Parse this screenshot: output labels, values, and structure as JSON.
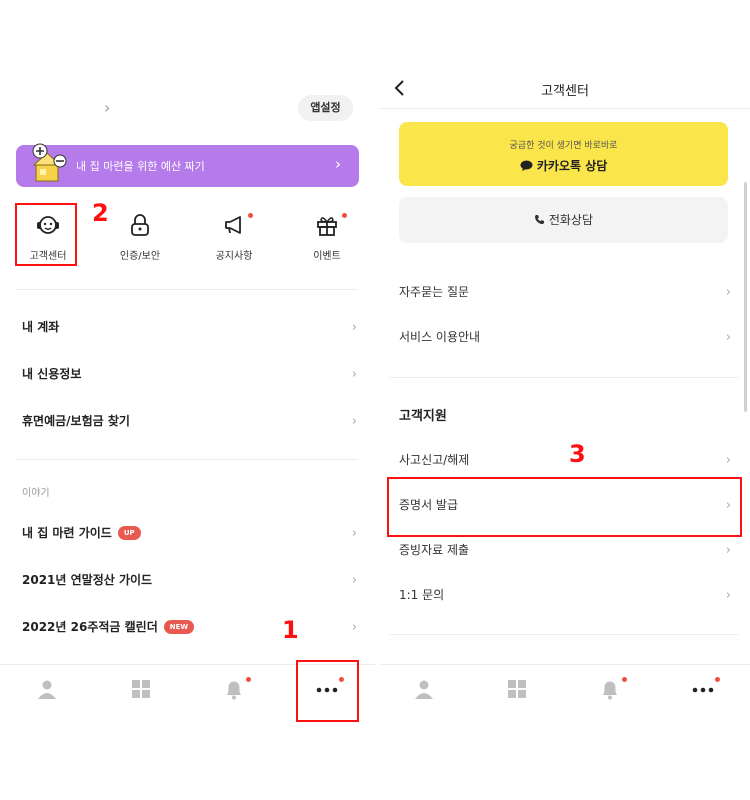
{
  "left": {
    "app_settings_label": "앱설정",
    "banner": {
      "text": "내 집 마련을 위한 예산 짜기",
      "color": "#b57bea"
    },
    "quick_menu": [
      {
        "label": "고객센터",
        "icon": "headset-icon"
      },
      {
        "label": "인증/보안",
        "icon": "lock-icon"
      },
      {
        "label": "공지사항",
        "icon": "megaphone-icon"
      },
      {
        "label": "이벤트",
        "icon": "gift-icon"
      }
    ],
    "menu": [
      {
        "label": "내 계좌"
      },
      {
        "label": "내 신용정보"
      },
      {
        "label": "휴면예금/보험금 찾기"
      }
    ],
    "section_label": "이야기",
    "stories": [
      {
        "label": "내 집 마련 가이드",
        "badge": "UP"
      },
      {
        "label": "2021년 연말정산 가이드",
        "badge": ""
      },
      {
        "label": "2022년 26주적금 캘린더",
        "badge": "NEW"
      }
    ],
    "tabs": [
      "person-icon",
      "grid-icon",
      "bell-icon",
      "more-icon"
    ]
  },
  "right": {
    "title": "고객센터",
    "kakao": {
      "subtitle": "궁금한 것이 생기면 바로바로",
      "label": "카카오톡 상담",
      "color": "#fae54a"
    },
    "phone_label": "전화상담",
    "faq_items": [
      {
        "label": "자주묻는 질문"
      },
      {
        "label": "서비스 이용안내"
      }
    ],
    "support_section": "고객지원",
    "support_items": [
      {
        "label": "사고신고/해제"
      },
      {
        "label": "증명서 발급"
      },
      {
        "label": "증빙자료 제출"
      },
      {
        "label": "1:1 문의"
      }
    ]
  },
  "annotations": [
    "1",
    "2",
    "3"
  ],
  "colors": {
    "annotation": "#ff1010",
    "notification_dot": "#f04f3f",
    "badge": "#e85a4f"
  }
}
